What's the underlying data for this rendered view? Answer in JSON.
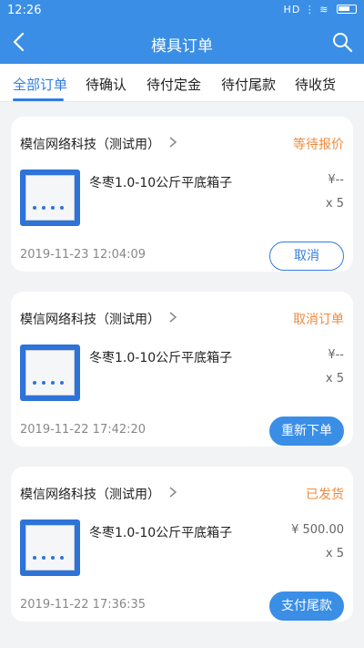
{
  "status_bar": {
    "time": "12:26",
    "indicators": "HD ⋮ ≋"
  },
  "header": {
    "title": "模具订单"
  },
  "tabs": [
    {
      "label": "全部订单",
      "active": true
    },
    {
      "label": "待确认",
      "active": false
    },
    {
      "label": "待付定金",
      "active": false
    },
    {
      "label": "待付尾款",
      "active": false
    },
    {
      "label": "待收货",
      "active": false
    }
  ],
  "orders": [
    {
      "shop": "模信网络科技（测试用）",
      "status": "等待报价",
      "product": "冬枣1.0-10公斤平底箱子",
      "price": "¥--",
      "qty": "x 5",
      "time": "2019-11-23 12:04:09",
      "action": "取消"
    },
    {
      "shop": "模信网络科技（测试用）",
      "status": "取消订单",
      "product": "冬枣1.0-10公斤平底箱子",
      "price": "¥--",
      "qty": "x 5",
      "time": "2019-11-22 17:42:20",
      "action": "重新下单"
    },
    {
      "shop": "模信网络科技（测试用）",
      "status": "已发货",
      "product": "冬枣1.0-10公斤平底箱子",
      "price": "¥ 500.00",
      "qty": "x 5",
      "time": "2019-11-22 17:36:35",
      "action": "支付尾款"
    }
  ],
  "colors": {
    "primary": "#3a8ee6",
    "status": "#f08a3c"
  }
}
